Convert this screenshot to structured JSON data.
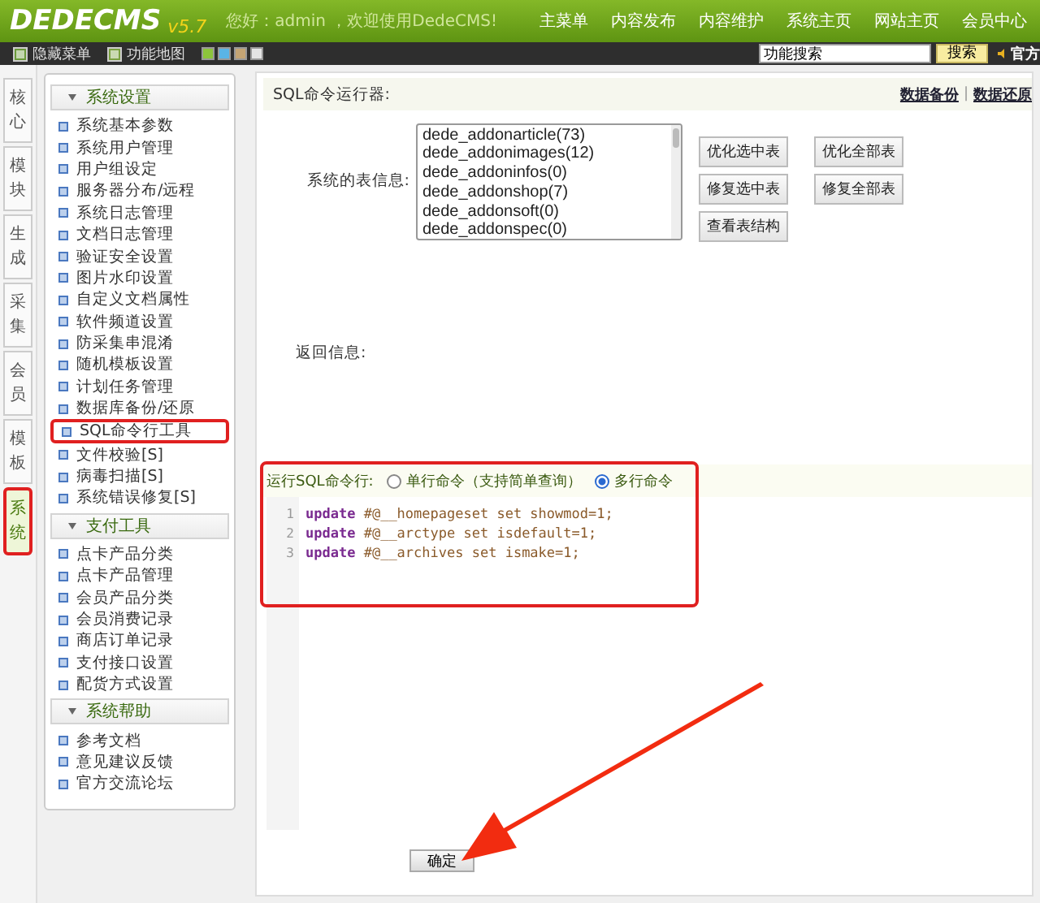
{
  "header": {
    "logo": "DEDECMS",
    "version": "v5.7",
    "greeting": "您好：admin ，欢迎使用DedeCMS!",
    "nav": [
      "主菜单",
      "内容发布",
      "内容维护",
      "系统主页",
      "网站主页",
      "会员中心"
    ]
  },
  "toolbar": {
    "items": [
      "隐藏菜单",
      "功能地图"
    ],
    "swatches": [
      {
        "color": "#8cc43c"
      },
      {
        "color": "#5ab4e6"
      },
      {
        "color": "#c4a474"
      },
      {
        "color": "#e4e4e4"
      }
    ],
    "search": {
      "value": "功能搜索"
    },
    "search_button": "搜索",
    "cut_link": "官方"
  },
  "side_tabs": [
    {
      "label": "核心",
      "selected": false,
      "highlighted": false
    },
    {
      "label": "模块",
      "selected": false,
      "highlighted": false
    },
    {
      "label": "生成",
      "selected": false,
      "highlighted": false
    },
    {
      "label": "采集",
      "selected": false,
      "highlighted": false
    },
    {
      "label": "会员",
      "selected": false,
      "highlighted": false
    },
    {
      "label": "模板",
      "selected": false,
      "highlighted": false
    },
    {
      "label": "系统",
      "selected": true,
      "highlighted": true
    }
  ],
  "menu_groups": [
    {
      "title": "系统设置",
      "expanded": true,
      "items": [
        {
          "label": "系统基本参数",
          "highlighted": false
        },
        {
          "label": "系统用户管理",
          "highlighted": false
        },
        {
          "label": "用户组设定",
          "highlighted": false
        },
        {
          "label": "服务器分布/远程",
          "highlighted": false
        },
        {
          "label": "系统日志管理",
          "highlighted": false
        },
        {
          "label": "文档日志管理",
          "highlighted": false
        },
        {
          "label": "验证安全设置",
          "highlighted": false
        },
        {
          "label": "图片水印设置",
          "highlighted": false
        },
        {
          "label": "自定义文档属性",
          "highlighted": false
        },
        {
          "label": "软件频道设置",
          "highlighted": false
        },
        {
          "label": "防采集串混淆",
          "highlighted": false
        },
        {
          "label": "随机模板设置",
          "highlighted": false
        },
        {
          "label": "计划任务管理",
          "highlighted": false
        },
        {
          "label": "数据库备份/还原",
          "highlighted": false
        },
        {
          "label": "SQL命令行工具",
          "highlighted": true
        },
        {
          "label": "文件校验[S]",
          "highlighted": false
        },
        {
          "label": "病毒扫描[S]",
          "highlighted": false
        },
        {
          "label": "系统错误修复[S]",
          "highlighted": false
        }
      ]
    },
    {
      "title": "支付工具",
      "expanded": true,
      "items": [
        {
          "label": "点卡产品分类",
          "highlighted": false
        },
        {
          "label": "点卡产品管理",
          "highlighted": false
        },
        {
          "label": "会员产品分类",
          "highlighted": false
        },
        {
          "label": "会员消费记录",
          "highlighted": false
        },
        {
          "label": "商店订单记录",
          "highlighted": false
        },
        {
          "label": "支付接口设置",
          "highlighted": false
        },
        {
          "label": "配货方式设置",
          "highlighted": false
        }
      ]
    },
    {
      "title": "系统帮助",
      "expanded": true,
      "items": [
        {
          "label": "参考文档",
          "highlighted": false
        },
        {
          "label": "意见建议反馈",
          "highlighted": false
        },
        {
          "label": "官方交流论坛",
          "highlighted": false
        }
      ]
    }
  ],
  "panel": {
    "title": "SQL命令运行器:",
    "links": [
      "数据备份",
      "数据还原"
    ],
    "separator": "|",
    "tables_label": "系统的表信息:",
    "tables": [
      "dede_addonarticle(73)",
      "dede_addonimages(12)",
      "dede_addoninfos(0)",
      "dede_addonshop(7)",
      "dede_addonsoft(0)",
      "dede_addonspec(0)"
    ],
    "table_buttons": [
      "优化选中表",
      "优化全部表",
      "修复选中表",
      "修复全部表",
      "查看表结构"
    ],
    "return_label": "返回信息:",
    "sql": {
      "label": "运行SQL命令行:",
      "highlighted": true,
      "modes": [
        {
          "label": "单行命令（支持简单查询）",
          "selected": false
        },
        {
          "label": "多行命令",
          "selected": true
        }
      ],
      "lines": [
        {
          "number": "1",
          "keyword": "update",
          "rest": "#@__homepageset set showmod=1;"
        },
        {
          "number": "2",
          "keyword": "update",
          "rest": "#@__arctype set isdefault=1;"
        },
        {
          "number": "3",
          "keyword": "update",
          "rest": "#@__archives set ismake=1;"
        }
      ]
    },
    "confirm": "确定"
  },
  "annotation": {
    "arrow": true
  }
}
